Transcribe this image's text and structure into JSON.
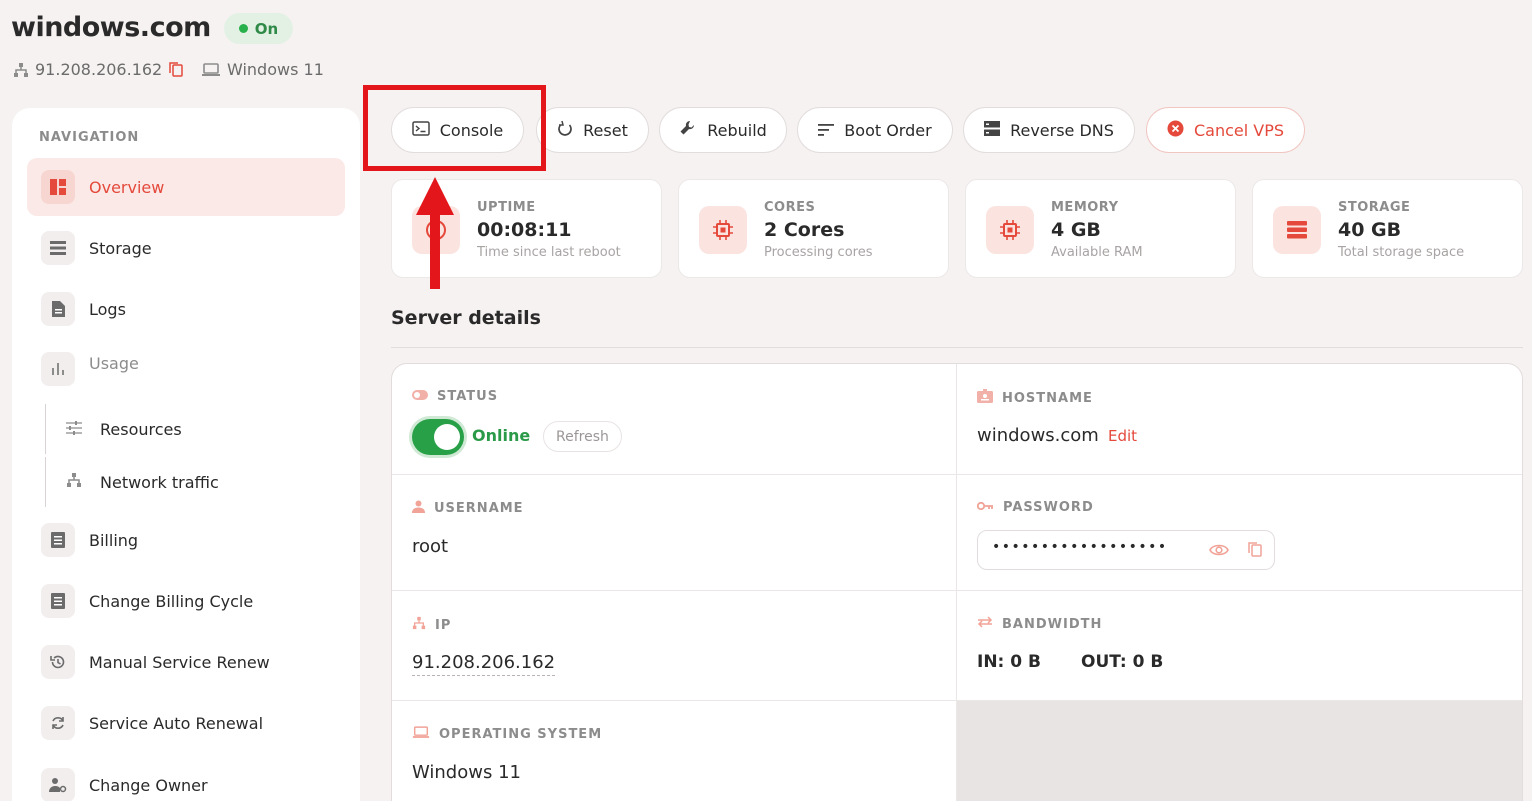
{
  "header": {
    "title": "windows.com",
    "status_badge": "On",
    "ip": "91.208.206.162",
    "os": "Windows 11"
  },
  "sidebar": {
    "heading": "NAVIGATION",
    "items": [
      {
        "label": "Overview",
        "icon": "dashboard-icon"
      },
      {
        "label": "Storage",
        "icon": "storage-icon"
      },
      {
        "label": "Logs",
        "icon": "document-icon"
      },
      {
        "label": "Usage",
        "icon": "bar-chart-icon"
      },
      {
        "label": "Resources",
        "icon": "sliders-icon"
      },
      {
        "label": "Network traffic",
        "icon": "network-icon"
      },
      {
        "label": "Billing",
        "icon": "invoice-icon"
      },
      {
        "label": "Change Billing Cycle",
        "icon": "invoice-icon"
      },
      {
        "label": "Manual Service Renew",
        "icon": "history-icon"
      },
      {
        "label": "Service Auto Renewal",
        "icon": "refresh-icon"
      },
      {
        "label": "Change Owner",
        "icon": "user-gear-icon"
      }
    ]
  },
  "toolbar": {
    "console": "Console",
    "reset": "Reset",
    "rebuild": "Rebuild",
    "boot_order": "Boot Order",
    "reverse_dns": "Reverse DNS",
    "cancel_vps": "Cancel VPS"
  },
  "stats": [
    {
      "label": "UPTIME",
      "value": "00:08:11",
      "hint": "Time since last reboot"
    },
    {
      "label": "CORES",
      "value": "2 Cores",
      "hint": "Processing cores"
    },
    {
      "label": "MEMORY",
      "value": "4 GB",
      "hint": "Available RAM"
    },
    {
      "label": "STORAGE",
      "value": "40 GB",
      "hint": "Total storage space"
    }
  ],
  "details": {
    "title": "Server details",
    "status_label": "STATUS",
    "status_value": "Online",
    "refresh": "Refresh",
    "hostname_label": "HOSTNAME",
    "hostname_value": "windows.com",
    "edit": "Edit",
    "username_label": "USERNAME",
    "username_value": "root",
    "password_label": "PASSWORD",
    "password_value": "••••••••••••••••••",
    "ip_label": "IP",
    "ip_value": "91.208.206.162",
    "bandwidth_label": "BANDWIDTH",
    "bandwidth_in": "IN: 0 B",
    "bandwidth_out": "OUT: 0 B",
    "os_label": "OPERATING SYSTEM",
    "os_value": "Windows 11"
  },
  "colors": {
    "accent": "#e4493b",
    "online": "#28a048",
    "annotation": "#e3171b"
  }
}
